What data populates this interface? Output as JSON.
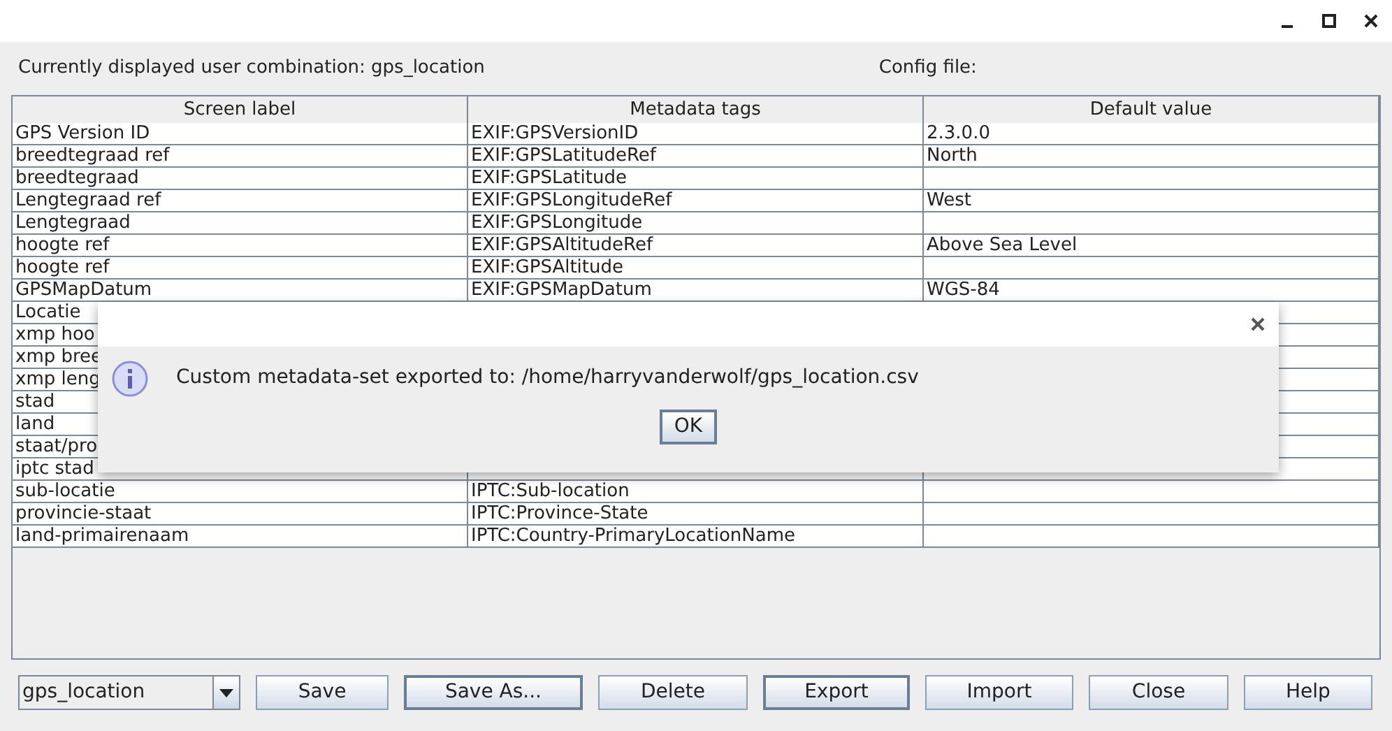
{
  "header": {
    "combination_label": "Currently displayed user combination: gps_location",
    "config_label": "Config file:"
  },
  "table": {
    "columns": [
      "Screen label",
      "Metadata tags",
      "Default value"
    ],
    "rows": [
      {
        "cells": [
          "GPS Version ID",
          "EXIF:GPSVersionID",
          "2.3.0.0"
        ]
      },
      {
        "cells": [
          "breedtegraad ref",
          "EXIF:GPSLatitudeRef",
          "North"
        ]
      },
      {
        "cells": [
          "breedtegraad",
          "EXIF:GPSLatitude"
        ]
      },
      {
        "cells": [
          "Lengtegraad ref",
          "EXIF:GPSLongitudeRef",
          "West"
        ]
      },
      {
        "cells": [
          "Lengtegraad",
          "EXIF:GPSLongitude"
        ]
      },
      {
        "cells": [
          "hoogte ref",
          "EXIF:GPSAltitudeRef",
          "Above Sea Level"
        ]
      },
      {
        "cells": [
          "hoogte ref",
          "EXIF:GPSAltitude"
        ]
      },
      {
        "cells": [
          "GPSMapDatum",
          "EXIF:GPSMapDatum",
          "WGS-84"
        ]
      },
      {
        "cells": [
          "Locatie"
        ]
      },
      {
        "cells": [
          "xmp hoo"
        ]
      },
      {
        "cells": [
          "xmp bree"
        ]
      },
      {
        "cells": [
          "xmp leng"
        ]
      },
      {
        "cells": [
          "stad"
        ]
      },
      {
        "cells": [
          "land"
        ]
      },
      {
        "cells": [
          "staat/pro"
        ]
      },
      {
        "cells": [
          "iptc stad"
        ]
      },
      {
        "cells": [
          "sub-locatie",
          "IPTC:Sub-location"
        ]
      },
      {
        "cells": [
          "provincie-staat",
          "IPTC:Province-State"
        ]
      },
      {
        "cells": [
          "land-primairenaam",
          "IPTC:Country-PrimaryLocationName"
        ]
      }
    ]
  },
  "combo": {
    "value": "gps_location"
  },
  "buttons": [
    {
      "label": "Save",
      "focused": false
    },
    {
      "label": "Save As...",
      "focused": true
    },
    {
      "label": "Delete",
      "focused": false
    },
    {
      "label": "Export",
      "focused": true
    },
    {
      "label": "Import",
      "focused": false
    },
    {
      "label": "Close",
      "focused": false
    },
    {
      "label": "Help",
      "focused": false
    }
  ],
  "dialog": {
    "message": "Custom metadata-set exported to: /home/harryvanderwolf/gps_location.csv",
    "button": "OK"
  }
}
